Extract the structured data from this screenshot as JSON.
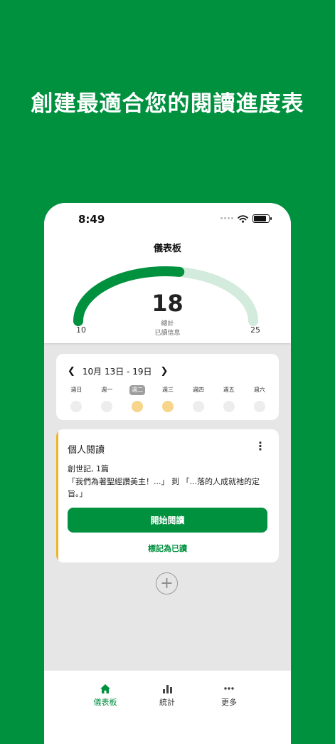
{
  "headline": "創建最適合您的閱讀進度表",
  "status": {
    "time": "8:49"
  },
  "nav": {
    "title": "儀表板"
  },
  "gauge": {
    "value": "18",
    "min": "10",
    "max": "25",
    "label_line1": "總計",
    "label_line2": "已讀信息",
    "fill_fraction": 0.55
  },
  "week": {
    "range": "10月 13日 - 19日",
    "days": [
      {
        "label": "週日",
        "selected": false,
        "done": false
      },
      {
        "label": "週一",
        "selected": false,
        "done": false
      },
      {
        "label": "週二",
        "selected": true,
        "done": true
      },
      {
        "label": "週三",
        "selected": false,
        "done": true
      },
      {
        "label": "週四",
        "selected": false,
        "done": false
      },
      {
        "label": "週五",
        "selected": false,
        "done": false
      },
      {
        "label": "週六",
        "selected": false,
        "done": false
      }
    ]
  },
  "plan": {
    "title": "個人閱讀",
    "book": "創世記, 1篇",
    "range": "「我們為著聖經讚美主！...」 到 「...落的人成就祂的定旨。」",
    "start_label": "開始閱讀",
    "mark_label": "標記為已讀"
  },
  "tabs": [
    {
      "label": "儀表板",
      "icon": "home-icon",
      "active": true
    },
    {
      "label": "統計",
      "icon": "bar-chart-icon",
      "active": false
    },
    {
      "label": "更多",
      "icon": "more-dots-icon",
      "active": false
    }
  ],
  "colors": {
    "brand": "#00913F",
    "gauge_track": "#D3EBDC",
    "accent_bar": "#F0B429",
    "done_dot": "#F7D58A"
  }
}
